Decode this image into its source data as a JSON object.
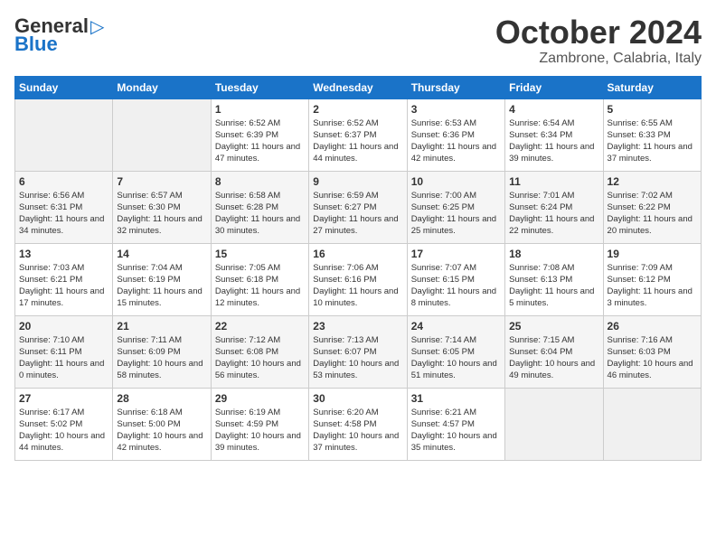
{
  "header": {
    "logo_general": "General",
    "logo_blue": "Blue",
    "month_title": "October 2024",
    "location": "Zambrone, Calabria, Italy"
  },
  "days_of_week": [
    "Sunday",
    "Monday",
    "Tuesday",
    "Wednesday",
    "Thursday",
    "Friday",
    "Saturday"
  ],
  "weeks": [
    [
      {
        "day": "",
        "sunrise": "",
        "sunset": "",
        "daylight": ""
      },
      {
        "day": "",
        "sunrise": "",
        "sunset": "",
        "daylight": ""
      },
      {
        "day": "1",
        "sunrise": "Sunrise: 6:52 AM",
        "sunset": "Sunset: 6:39 PM",
        "daylight": "Daylight: 11 hours and 47 minutes."
      },
      {
        "day": "2",
        "sunrise": "Sunrise: 6:52 AM",
        "sunset": "Sunset: 6:37 PM",
        "daylight": "Daylight: 11 hours and 44 minutes."
      },
      {
        "day": "3",
        "sunrise": "Sunrise: 6:53 AM",
        "sunset": "Sunset: 6:36 PM",
        "daylight": "Daylight: 11 hours and 42 minutes."
      },
      {
        "day": "4",
        "sunrise": "Sunrise: 6:54 AM",
        "sunset": "Sunset: 6:34 PM",
        "daylight": "Daylight: 11 hours and 39 minutes."
      },
      {
        "day": "5",
        "sunrise": "Sunrise: 6:55 AM",
        "sunset": "Sunset: 6:33 PM",
        "daylight": "Daylight: 11 hours and 37 minutes."
      }
    ],
    [
      {
        "day": "6",
        "sunrise": "Sunrise: 6:56 AM",
        "sunset": "Sunset: 6:31 PM",
        "daylight": "Daylight: 11 hours and 34 minutes."
      },
      {
        "day": "7",
        "sunrise": "Sunrise: 6:57 AM",
        "sunset": "Sunset: 6:30 PM",
        "daylight": "Daylight: 11 hours and 32 minutes."
      },
      {
        "day": "8",
        "sunrise": "Sunrise: 6:58 AM",
        "sunset": "Sunset: 6:28 PM",
        "daylight": "Daylight: 11 hours and 30 minutes."
      },
      {
        "day": "9",
        "sunrise": "Sunrise: 6:59 AM",
        "sunset": "Sunset: 6:27 PM",
        "daylight": "Daylight: 11 hours and 27 minutes."
      },
      {
        "day": "10",
        "sunrise": "Sunrise: 7:00 AM",
        "sunset": "Sunset: 6:25 PM",
        "daylight": "Daylight: 11 hours and 25 minutes."
      },
      {
        "day": "11",
        "sunrise": "Sunrise: 7:01 AM",
        "sunset": "Sunset: 6:24 PM",
        "daylight": "Daylight: 11 hours and 22 minutes."
      },
      {
        "day": "12",
        "sunrise": "Sunrise: 7:02 AM",
        "sunset": "Sunset: 6:22 PM",
        "daylight": "Daylight: 11 hours and 20 minutes."
      }
    ],
    [
      {
        "day": "13",
        "sunrise": "Sunrise: 7:03 AM",
        "sunset": "Sunset: 6:21 PM",
        "daylight": "Daylight: 11 hours and 17 minutes."
      },
      {
        "day": "14",
        "sunrise": "Sunrise: 7:04 AM",
        "sunset": "Sunset: 6:19 PM",
        "daylight": "Daylight: 11 hours and 15 minutes."
      },
      {
        "day": "15",
        "sunrise": "Sunrise: 7:05 AM",
        "sunset": "Sunset: 6:18 PM",
        "daylight": "Daylight: 11 hours and 12 minutes."
      },
      {
        "day": "16",
        "sunrise": "Sunrise: 7:06 AM",
        "sunset": "Sunset: 6:16 PM",
        "daylight": "Daylight: 11 hours and 10 minutes."
      },
      {
        "day": "17",
        "sunrise": "Sunrise: 7:07 AM",
        "sunset": "Sunset: 6:15 PM",
        "daylight": "Daylight: 11 hours and 8 minutes."
      },
      {
        "day": "18",
        "sunrise": "Sunrise: 7:08 AM",
        "sunset": "Sunset: 6:13 PM",
        "daylight": "Daylight: 11 hours and 5 minutes."
      },
      {
        "day": "19",
        "sunrise": "Sunrise: 7:09 AM",
        "sunset": "Sunset: 6:12 PM",
        "daylight": "Daylight: 11 hours and 3 minutes."
      }
    ],
    [
      {
        "day": "20",
        "sunrise": "Sunrise: 7:10 AM",
        "sunset": "Sunset: 6:11 PM",
        "daylight": "Daylight: 11 hours and 0 minutes."
      },
      {
        "day": "21",
        "sunrise": "Sunrise: 7:11 AM",
        "sunset": "Sunset: 6:09 PM",
        "daylight": "Daylight: 10 hours and 58 minutes."
      },
      {
        "day": "22",
        "sunrise": "Sunrise: 7:12 AM",
        "sunset": "Sunset: 6:08 PM",
        "daylight": "Daylight: 10 hours and 56 minutes."
      },
      {
        "day": "23",
        "sunrise": "Sunrise: 7:13 AM",
        "sunset": "Sunset: 6:07 PM",
        "daylight": "Daylight: 10 hours and 53 minutes."
      },
      {
        "day": "24",
        "sunrise": "Sunrise: 7:14 AM",
        "sunset": "Sunset: 6:05 PM",
        "daylight": "Daylight: 10 hours and 51 minutes."
      },
      {
        "day": "25",
        "sunrise": "Sunrise: 7:15 AM",
        "sunset": "Sunset: 6:04 PM",
        "daylight": "Daylight: 10 hours and 49 minutes."
      },
      {
        "day": "26",
        "sunrise": "Sunrise: 7:16 AM",
        "sunset": "Sunset: 6:03 PM",
        "daylight": "Daylight: 10 hours and 46 minutes."
      }
    ],
    [
      {
        "day": "27",
        "sunrise": "Sunrise: 6:17 AM",
        "sunset": "Sunset: 5:02 PM",
        "daylight": "Daylight: 10 hours and 44 minutes."
      },
      {
        "day": "28",
        "sunrise": "Sunrise: 6:18 AM",
        "sunset": "Sunset: 5:00 PM",
        "daylight": "Daylight: 10 hours and 42 minutes."
      },
      {
        "day": "29",
        "sunrise": "Sunrise: 6:19 AM",
        "sunset": "Sunset: 4:59 PM",
        "daylight": "Daylight: 10 hours and 39 minutes."
      },
      {
        "day": "30",
        "sunrise": "Sunrise: 6:20 AM",
        "sunset": "Sunset: 4:58 PM",
        "daylight": "Daylight: 10 hours and 37 minutes."
      },
      {
        "day": "31",
        "sunrise": "Sunrise: 6:21 AM",
        "sunset": "Sunset: 4:57 PM",
        "daylight": "Daylight: 10 hours and 35 minutes."
      },
      {
        "day": "",
        "sunrise": "",
        "sunset": "",
        "daylight": ""
      },
      {
        "day": "",
        "sunrise": "",
        "sunset": "",
        "daylight": ""
      }
    ]
  ]
}
